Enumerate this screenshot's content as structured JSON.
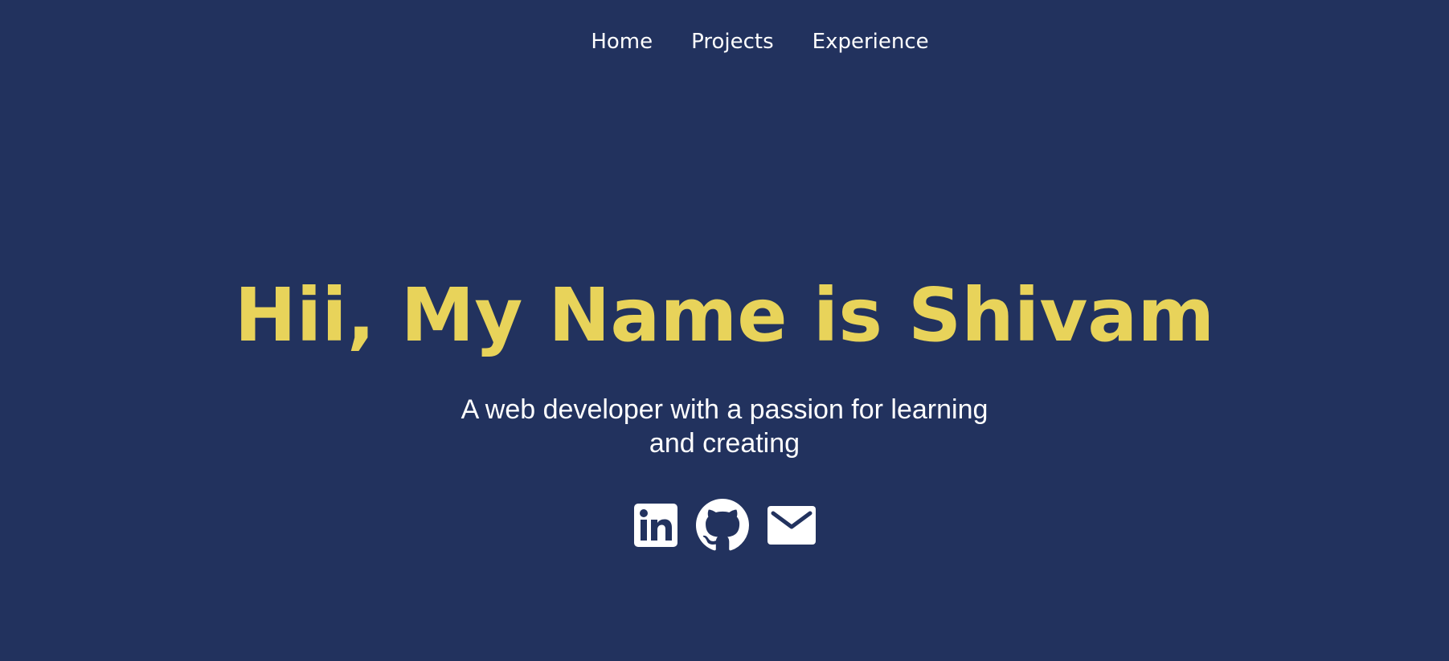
{
  "nav": {
    "items": [
      {
        "label": "Home"
      },
      {
        "label": "Projects"
      },
      {
        "label": "Experience"
      }
    ]
  },
  "hero": {
    "title": "Hii, My Name is Shivam",
    "subtitle": "A web developer with a passion for learning and creating"
  },
  "social": {
    "icons": [
      "linkedin-icon",
      "github-icon",
      "mail-icon"
    ]
  },
  "colors": {
    "background": "#22325e",
    "accent": "#e8d35a",
    "text": "#ffffff"
  }
}
